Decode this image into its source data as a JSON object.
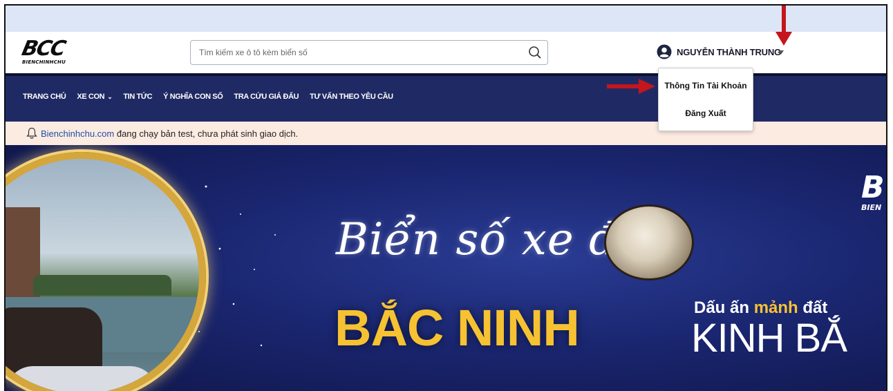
{
  "logo": {
    "mark": "BCC",
    "subtitle": "BIENCHINHCHU"
  },
  "search": {
    "placeholder": "Tìm kiếm xe ô tô kèm biển số",
    "icon": "search-icon"
  },
  "user": {
    "name": "NGUYỄN THÀNH TRUNG",
    "avatar_icon": "user-circle-icon",
    "caret_icon": "caret-down-icon"
  },
  "user_menu": {
    "items": [
      {
        "label": "Thông Tin Tài Khoản"
      },
      {
        "label": "Đăng Xuất"
      }
    ]
  },
  "nav": {
    "items": [
      {
        "label": "TRANG CHỦ"
      },
      {
        "label": "XE CON",
        "has_dropdown": true
      },
      {
        "label": "TIN TỨC"
      },
      {
        "label": "Ý NGHĨA CON SỐ"
      },
      {
        "label": "TRA CỨU GIÁ ĐẤU"
      },
      {
        "label": "TƯ VẤN THEO YÊU CẦU"
      }
    ]
  },
  "notice": {
    "icon": "bell-icon",
    "link": "Bienchinhchu.com",
    "text": " đang chạy bản test, chưa phát sinh giao dịch."
  },
  "hero": {
    "script_title": "Biển số xe đẹp",
    "title": "BẮC NINH",
    "subtitle_part1": "Dấu ấn ",
    "subtitle_highlight": "mảnh",
    "subtitle_part2": " đất",
    "subtitle_big": "KINH BẮ",
    "corner_logo_mark": "B",
    "corner_logo_sub": "BIEN"
  },
  "annotations": {
    "arrow_color": "#c4161c"
  },
  "colors": {
    "nav_bg": "#1f2a64",
    "notice_bg": "#fcebe1",
    "title_gold": "#f6c232"
  }
}
